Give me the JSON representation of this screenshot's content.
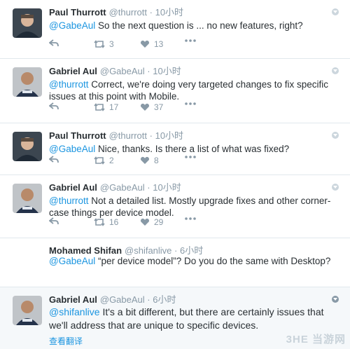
{
  "tweets": [
    {
      "name": "Paul Thurrott",
      "handle": "@thurrott",
      "time": "10小时",
      "mention": "@GabeAul",
      "text": " So the next question is ... no new features, right?",
      "retweets": "3",
      "likes": "13",
      "avatar": "paul"
    },
    {
      "name": "Gabriel Aul",
      "handle": "@GabeAul",
      "time": "10小时",
      "mention": "@thurrott",
      "text": " Correct, we're doing very targeted changes to fix specific issues at this point with Mobile.",
      "retweets": "17",
      "likes": "37",
      "avatar": "gabe"
    },
    {
      "name": "Paul Thurrott",
      "handle": "@thurrott",
      "time": "10小时",
      "mention": "@GabeAul",
      "text": " Nice, thanks. Is there a list of what was fixed?",
      "retweets": "2",
      "likes": "8",
      "avatar": "paul"
    },
    {
      "name": "Gabriel Aul",
      "handle": "@GabeAul",
      "time": "10小时",
      "mention": "@thurrott",
      "text": " Not a detailed list. Mostly upgrade fixes and other corner-case things per device model.",
      "retweets": "16",
      "likes": "29",
      "avatar": "gabe"
    },
    {
      "name": "Mohamed Shifan",
      "handle": "@shifanlive",
      "time": "6小时",
      "mention": "@GabeAul",
      "text": " “per device model”? Do you do the same with Desktop?",
      "avatar": "none"
    },
    {
      "name": "Gabriel Aul",
      "handle": "@GabeAul",
      "time": "6小时",
      "mention": "@shifanlive",
      "text": " It's a bit different, but there are certainly issues that we'll address that are unique to specific devices.",
      "translate": "查看翻译",
      "avatar": "gabe"
    }
  ],
  "separator": "·",
  "watermark": "3HE 当游网",
  "colors": {
    "accent": "#1b95e0",
    "muted": "#8899a6",
    "highlight": "#f5f8fa"
  }
}
